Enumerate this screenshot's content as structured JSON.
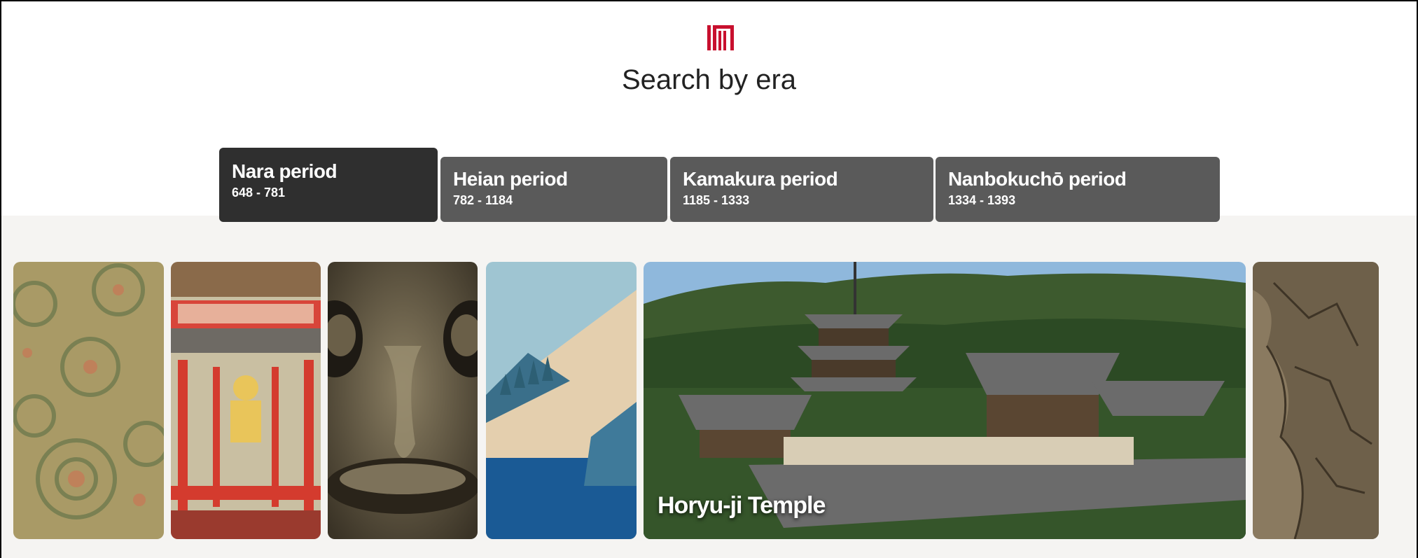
{
  "header": {
    "logo_icon": "museum-logo-icon",
    "logo_color": "#c8102e",
    "title": "Search by era"
  },
  "tabs": [
    {
      "label": "Nara period",
      "years": "648 - 781",
      "active": true
    },
    {
      "label": "Heian period",
      "years": "782 - 1184",
      "active": false
    },
    {
      "label": "Kamakura period",
      "years": "1185 - 1333",
      "active": false
    },
    {
      "label": "Nanbokuchō period",
      "years": "1334 - 1393",
      "active": false
    }
  ],
  "gallery": {
    "items": [
      {
        "kind": "textile-pattern"
      },
      {
        "kind": "buddhist-painting"
      },
      {
        "kind": "bronze-mask"
      },
      {
        "kind": "landscape-painting"
      },
      {
        "kind": "temple-photo",
        "caption": "Horyu-ji Temple"
      },
      {
        "kind": "map-fragment"
      }
    ]
  },
  "colors": {
    "active_tab": "#2f2f2f",
    "inactive_tab": "#5a5a5a",
    "band": "#f5f4f2"
  }
}
